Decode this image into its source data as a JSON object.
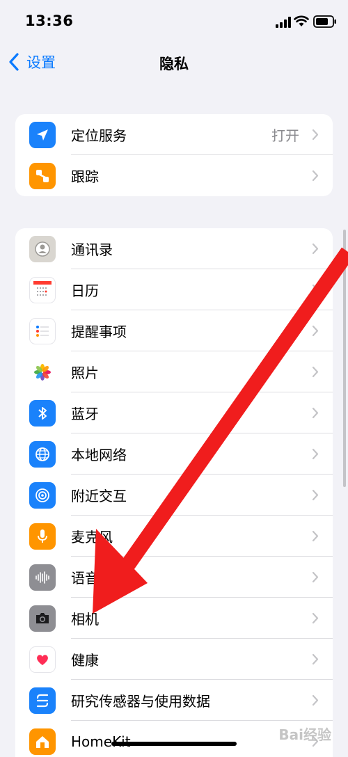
{
  "status_bar": {
    "time": "13:36"
  },
  "nav": {
    "back_label": "设置",
    "title": "隐私"
  },
  "group1": [
    {
      "label": "定位服务",
      "value": "打开",
      "icon": "location-arrow-icon",
      "color": "#1a82fb"
    },
    {
      "label": "跟踪",
      "value": "",
      "icon": "tracking-icon",
      "color": "#ff9500"
    }
  ],
  "group2": [
    {
      "label": "通讯录",
      "icon": "contacts-icon",
      "color": "#c9c9ce"
    },
    {
      "label": "日历",
      "icon": "calendar-icon",
      "color": "#ffffff"
    },
    {
      "label": "提醒事项",
      "icon": "reminders-icon",
      "color": "#ffffff"
    },
    {
      "label": "照片",
      "icon": "photos-icon",
      "color": "#ffffff"
    },
    {
      "label": "蓝牙",
      "icon": "bluetooth-icon",
      "color": "#1a82fb"
    },
    {
      "label": "本地网络",
      "icon": "globe-icon",
      "color": "#1a82fb"
    },
    {
      "label": "附近交互",
      "icon": "nearby-icon",
      "color": "#1a82fb"
    },
    {
      "label": "麦克风",
      "icon": "microphone-icon",
      "color": "#ff9500"
    },
    {
      "label": "语音识别",
      "icon": "waveform-icon",
      "color": "#8e8e93"
    },
    {
      "label": "相机",
      "icon": "camera-icon",
      "color": "#8e8e93"
    },
    {
      "label": "健康",
      "icon": "heart-icon",
      "color": "#ffffff"
    },
    {
      "label": "研究传感器与使用数据",
      "icon": "research-icon",
      "color": "#1a82fb"
    },
    {
      "label": "HomeKit",
      "icon": "home-icon",
      "color": "#ff9500"
    }
  ],
  "watermark": "Bai经验"
}
